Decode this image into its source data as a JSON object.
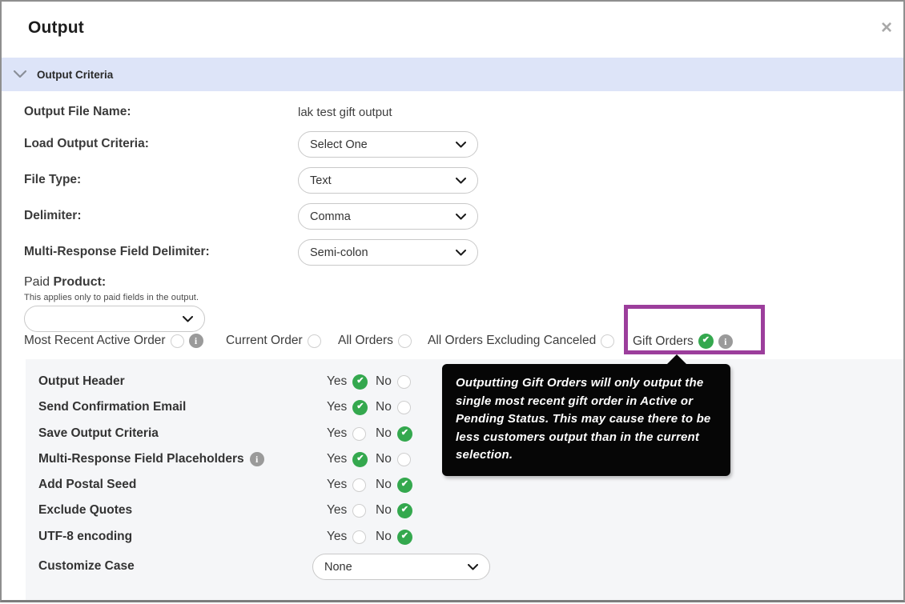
{
  "dialog": {
    "title": "Output"
  },
  "icons": {
    "close": "×",
    "info": "i",
    "check": "✔"
  },
  "section": {
    "title": "Output Criteria"
  },
  "fields": {
    "output_file_name": {
      "label": "Output File Name:",
      "value": "lak test gift output"
    },
    "load_output_criteria": {
      "label": "Load Output Criteria:",
      "value": "Select One"
    },
    "file_type": {
      "label": "File Type:",
      "value": "Text"
    },
    "delimiter": {
      "label": "Delimiter:",
      "value": "Comma"
    },
    "multi_response_delimiter": {
      "label": "Multi-Response Field Delimiter:",
      "value": "Semi-colon"
    }
  },
  "paid_product": {
    "label_normal": "Paid ",
    "label_bold": "Product:",
    "helper": "This applies only to paid fields in the output.",
    "dropdown_value": "",
    "options": [
      {
        "label": "Most Recent Active Order",
        "selected": false,
        "has_info": true
      },
      {
        "label": "Current Order",
        "selected": false
      },
      {
        "label": "All Orders",
        "selected": false
      },
      {
        "label": "All Orders Excluding Canceled",
        "selected": false
      },
      {
        "label": "Gift Orders",
        "selected": true,
        "has_info": true,
        "highlighted": true
      }
    ]
  },
  "tooltip": {
    "text": "Outputting Gift Orders will only output the single most recent gift order in Active or Pending Status. This may cause there to be less customers output than in the current selection."
  },
  "labels": {
    "yes": "Yes",
    "no": "No"
  },
  "toggles": [
    {
      "label": "Output Header",
      "value": "Yes"
    },
    {
      "label": "Send Confirmation Email",
      "value": "Yes"
    },
    {
      "label": "Save Output Criteria",
      "value": "No"
    },
    {
      "label": "Multi-Response Field Placeholders",
      "value": "Yes",
      "has_info": true
    },
    {
      "label": "Add Postal Seed",
      "value": "No"
    },
    {
      "label": "Exclude Quotes",
      "value": "No"
    },
    {
      "label": "UTF-8 encoding",
      "value": "No"
    }
  ],
  "customize_case": {
    "label": "Customize Case",
    "value": "None"
  },
  "colors": {
    "accent_green": "#34a84e",
    "highlight_purple": "#9c3e9c",
    "section_bar_bg": "#dde4f8",
    "tooltip_bg": "#060606",
    "panel_bg": "#f5f6f8"
  }
}
